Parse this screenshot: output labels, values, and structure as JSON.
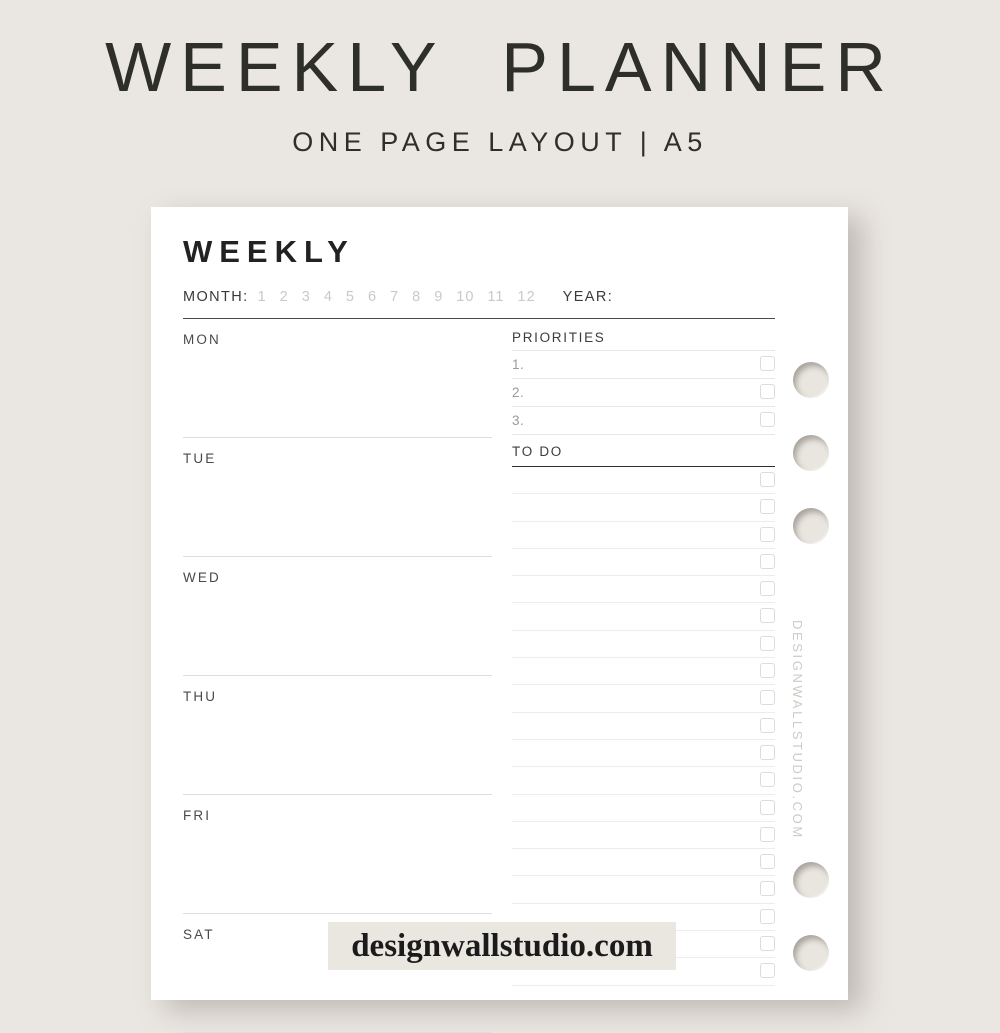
{
  "header": {
    "title": "WEEKLY  PLANNER",
    "subtitle": "ONE PAGE LAYOUT | A5"
  },
  "page": {
    "weekly_title": "WEEKLY",
    "month_label": "MONTH:",
    "month_numbers": [
      "1",
      "2",
      "3",
      "4",
      "5",
      "6",
      "7",
      "8",
      "9",
      "10",
      "11",
      "12"
    ],
    "year_label": "YEAR:",
    "days": [
      {
        "label": "MON"
      },
      {
        "label": "TUE"
      },
      {
        "label": "WED"
      },
      {
        "label": "THU"
      },
      {
        "label": "FRI"
      },
      {
        "label": "SAT"
      }
    ],
    "priorities": {
      "title": "PRIORITIES",
      "rows": [
        "1.",
        "2.",
        "3."
      ]
    },
    "todo": {
      "title": "TO DO",
      "row_count": 19
    }
  },
  "watermarks": {
    "vertical": "DESIGNWALLSTUDIO.COM",
    "bottom": "designwallstudio.com"
  },
  "colors": {
    "background": "#eae6e1",
    "paper": "#ffffff",
    "ink": "#2e2e2b",
    "rule_strong": "#4a4a4a",
    "rule_light": "#e6e6e6",
    "muted": "#c9c9c9"
  }
}
